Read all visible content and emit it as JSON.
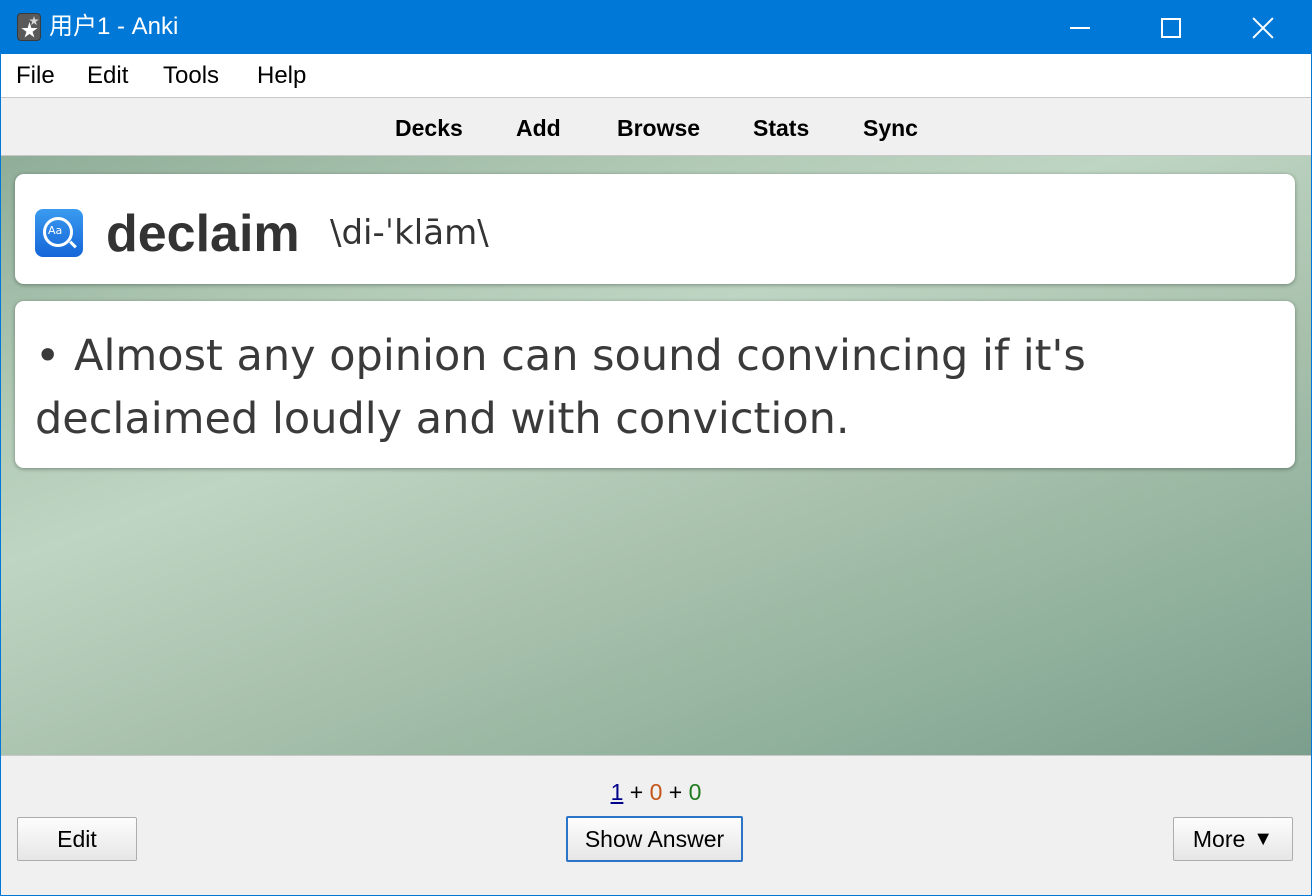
{
  "window": {
    "title": "用户1 - Anki"
  },
  "menu": {
    "items": [
      "File",
      "Edit",
      "Tools",
      "Help"
    ]
  },
  "toolbar": {
    "links": [
      "Decks",
      "Add",
      "Browse",
      "Stats",
      "Sync"
    ]
  },
  "card": {
    "word": "declaim",
    "phonetic": "\\di-ˈklām\\",
    "example": "• Almost any opinion can sound convincing if it's declaimed loudly and with conviction."
  },
  "bottom": {
    "counts": {
      "new": "1",
      "learning": "0",
      "review": "0",
      "separator": "+"
    },
    "edit_label": "Edit",
    "show_answer_label": "Show Answer",
    "more_label": "More",
    "more_arrow": "▼"
  },
  "colors": {
    "titlebar": "#0078d7",
    "count_new": "#00008b",
    "count_learning": "#c35617",
    "count_review": "#1e7b1e"
  },
  "icons": {
    "app": "anki-star-icon",
    "dictionary": "dictionary-icon"
  }
}
